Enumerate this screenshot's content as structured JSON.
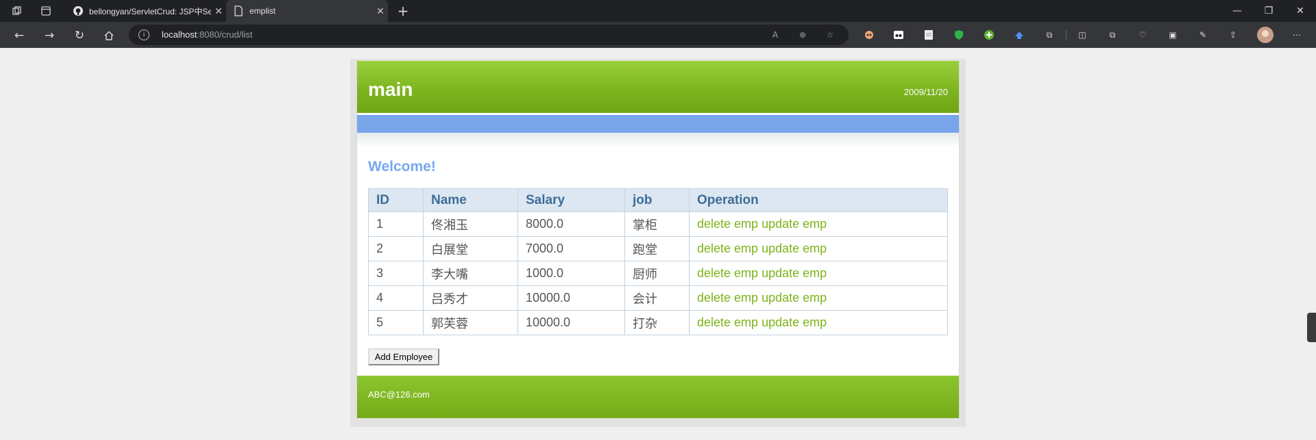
{
  "browser": {
    "tabs": [
      {
        "title": "bellongyan/ServletCrud: JSP中Se",
        "active": false,
        "icon": "github-icon"
      },
      {
        "title": "emplist",
        "active": true,
        "icon": "page-icon"
      }
    ],
    "url_host": "localhost",
    "url_path": ":8080/crud/list"
  },
  "page": {
    "site_title": "main",
    "date": "2009/11/20",
    "welcome": "Welcome!",
    "table": {
      "headers": [
        "ID",
        "Name",
        "Salary",
        "job",
        "Operation"
      ],
      "rows": [
        {
          "id": "1",
          "name": "佟湘玉",
          "salary": "8000.0",
          "job": "掌柜",
          "delete": "delete emp",
          "update": "update emp"
        },
        {
          "id": "2",
          "name": "白展堂",
          "salary": "7000.0",
          "job": "跑堂",
          "delete": "delete emp",
          "update": "update emp"
        },
        {
          "id": "3",
          "name": "李大嘴",
          "salary": "1000.0",
          "job": "厨师",
          "delete": "delete emp",
          "update": "update emp"
        },
        {
          "id": "4",
          "name": "吕秀才",
          "salary": "10000.0",
          "job": "会计",
          "delete": "delete emp",
          "update": "update emp"
        },
        {
          "id": "5",
          "name": "郭芙蓉",
          "salary": "10000.0",
          "job": "打杂",
          "delete": "delete emp",
          "update": "update emp"
        }
      ]
    },
    "add_button": "Add Employee",
    "footer": "ABC@126.com"
  },
  "colors": {
    "header_green": "#7db51f",
    "nav_blue": "#79a5eb",
    "welcome_blue": "#78a8ee",
    "link_green": "#7cb31a"
  }
}
